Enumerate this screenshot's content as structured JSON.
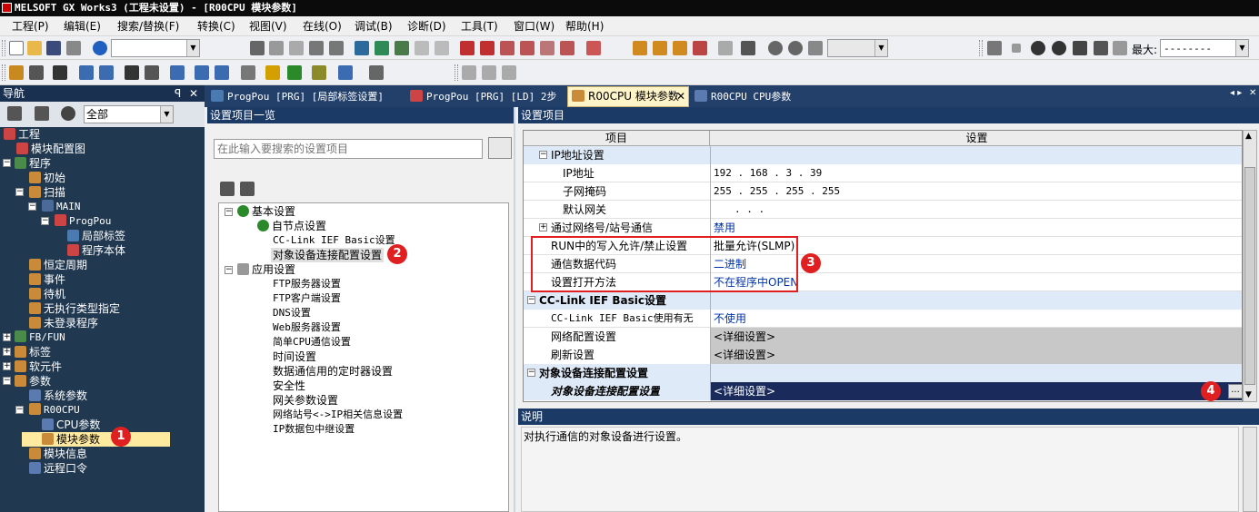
{
  "window": {
    "title": "MELSOFT GX Works3 (工程未设置) - [R00CPU 模块参数]"
  },
  "menu": [
    "工程(P)",
    "编辑(E)",
    "搜索/替换(F)",
    "转换(C)",
    "视图(V)",
    "在线(O)",
    "调试(B)",
    "诊断(D)",
    "工具(T)",
    "窗口(W)",
    "帮助(H)"
  ],
  "toolbar": {
    "max_label": "最大:",
    "max_value": "--------"
  },
  "nav": {
    "title": "导航",
    "pin": "ꟼ",
    "close": "✕",
    "filter": "全部",
    "items": [
      {
        "label": "工程"
      },
      {
        "label": "模块配置图"
      },
      {
        "label": "程序"
      },
      {
        "label": "初始"
      },
      {
        "label": "扫描"
      },
      {
        "label": "MAIN"
      },
      {
        "label": "ProgPou"
      },
      {
        "label": "局部标签"
      },
      {
        "label": "程序本体"
      },
      {
        "label": "恒定周期"
      },
      {
        "label": "事件"
      },
      {
        "label": "待机"
      },
      {
        "label": "无执行类型指定"
      },
      {
        "label": "未登录程序"
      },
      {
        "label": "FB/FUN"
      },
      {
        "label": "标签"
      },
      {
        "label": "软元件"
      },
      {
        "label": "参数"
      },
      {
        "label": "系统参数"
      },
      {
        "label": "R00CPU"
      },
      {
        "label": "CPU参数"
      },
      {
        "label": "模块参数"
      },
      {
        "label": "模块信息"
      },
      {
        "label": "远程口令"
      }
    ]
  },
  "tabs": [
    {
      "label": "ProgPou [PRG] [局部标签设置]"
    },
    {
      "label": "ProgPou [PRG] [LD] 2步"
    },
    {
      "label": "R00CPU 模块参数"
    },
    {
      "label": "R00CPU CPU参数"
    }
  ],
  "settings_list": {
    "title": "设置项目一览",
    "search_placeholder": "在此输入要搜索的设置项目",
    "items": [
      {
        "label": "基本设置"
      },
      {
        "label": "自节点设置"
      },
      {
        "label": "CC-Link IEF Basic设置"
      },
      {
        "label": "对象设备连接配置设置"
      },
      {
        "label": "应用设置"
      },
      {
        "label": "FTP服务器设置"
      },
      {
        "label": "FTP客户端设置"
      },
      {
        "label": "DNS设置"
      },
      {
        "label": "Web服务器设置"
      },
      {
        "label": "简单CPU通信设置"
      },
      {
        "label": "时间设置"
      },
      {
        "label": "数据通信用的定时器设置"
      },
      {
        "label": "安全性"
      },
      {
        "label": "网关参数设置"
      },
      {
        "label": "网络站号<->IP相关信息设置"
      },
      {
        "label": "IP数据包中继设置"
      }
    ]
  },
  "settings_grid": {
    "title": "设置项目",
    "col_item": "项目",
    "col_setting": "设置",
    "rows": [
      {
        "item": "IP地址设置",
        "value": ""
      },
      {
        "item": "IP地址",
        "value": "192 . 168 .  3 .  39"
      },
      {
        "item": "子网掩码",
        "value": "255 . 255 . 255 . 255"
      },
      {
        "item": "默认网关",
        "value": " .    .    ."
      },
      {
        "item": "通过网络号/站号通信",
        "value": "禁用"
      },
      {
        "item": "RUN中的写入允许/禁止设置",
        "value": "批量允许(SLMP)"
      },
      {
        "item": "通信数据代码",
        "value": "二进制"
      },
      {
        "item": "设置打开方法",
        "value": "不在程序中OPEN"
      },
      {
        "item": "CC-Link IEF Basic设置",
        "value": ""
      },
      {
        "item": "CC-Link IEF Basic使用有无",
        "value": "不使用"
      },
      {
        "item": "网络配置设置",
        "value": "<详细设置>"
      },
      {
        "item": "刷新设置",
        "value": "<详细设置>"
      },
      {
        "item": "对象设备连接配置设置",
        "value": ""
      },
      {
        "item": "对象设备连接配置设置",
        "value": "<详细设置>"
      }
    ],
    "ellipsis": "..."
  },
  "description": {
    "title": "说明",
    "text": "对执行通信的对象设备进行设置。"
  },
  "badges": [
    "1",
    "2",
    "3",
    "4"
  ]
}
